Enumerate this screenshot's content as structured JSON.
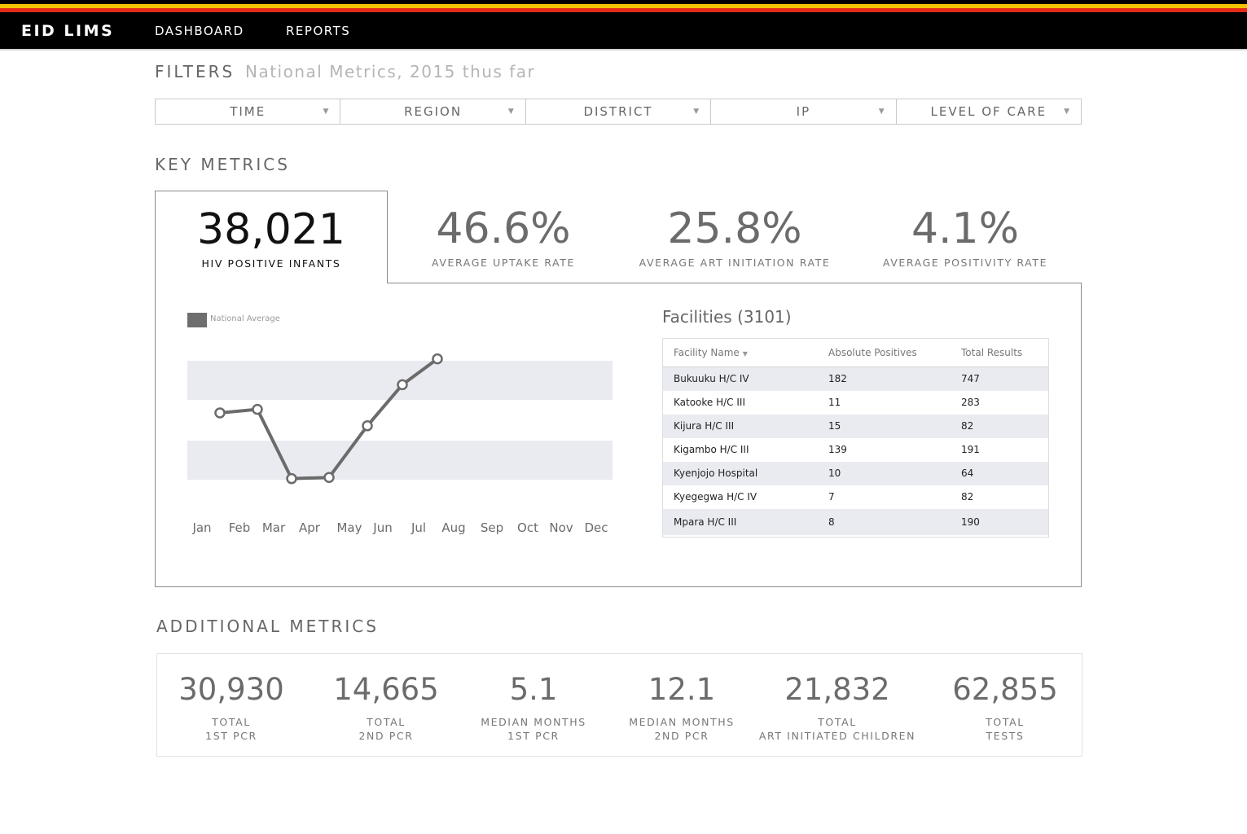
{
  "app": {
    "brand": "EID LIMS",
    "nav": [
      {
        "label": "DASHBOARD"
      },
      {
        "label": "REPORTS"
      }
    ],
    "stripe_colors": [
      "#000000",
      "#f2c400",
      "#e32b19",
      "#000000"
    ]
  },
  "filters": {
    "title": "FILTERS",
    "subtitle": "National Metrics, 2015 thus far",
    "items": [
      {
        "label": "TIME"
      },
      {
        "label": "REGION"
      },
      {
        "label": "DISTRICT"
      },
      {
        "label": "IP"
      },
      {
        "label": "LEVEL OF CARE"
      }
    ]
  },
  "key_metrics": {
    "title": "KEY METRICS",
    "items": [
      {
        "value": "38,021",
        "label": "HIV POSITIVE INFANTS",
        "active": true
      },
      {
        "value": "46.6%",
        "label": "AVERAGE UPTAKE RATE"
      },
      {
        "value": "25.8%",
        "label": "AVERAGE ART INITIATION RATE"
      },
      {
        "value": "4.1%",
        "label": "AVERAGE POSITIVITY RATE"
      }
    ]
  },
  "chart": {
    "legend": "National Average",
    "months": [
      "Jan",
      "Feb",
      "Mar",
      "Apr",
      "May",
      "Jun",
      "Jul",
      "Aug",
      "Sep",
      "Oct",
      "Nov",
      "Dec"
    ],
    "line_color": "#6b6b6b"
  },
  "chart_data": {
    "type": "line",
    "categories": [
      "Jan",
      "Feb",
      "Mar",
      "Apr",
      "May",
      "Jun",
      "Jul",
      "Aug",
      "Sep",
      "Oct",
      "Nov",
      "Dec"
    ],
    "series": [
      {
        "name": "National Average",
        "values": [
          0.59,
          0.62,
          0.03,
          0.04,
          0.48,
          0.83,
          1.05,
          null,
          null,
          null,
          null,
          null
        ]
      }
    ],
    "ylim": [
      0,
      1.2
    ],
    "legend_position": "top-left"
  },
  "facilities": {
    "title": "Facilities (3101)",
    "columns": [
      "Facility Name",
      "Absolute Positives",
      "Total Results"
    ],
    "rows": [
      {
        "name": "Bukuuku H/C IV",
        "positives": "182",
        "total": "747"
      },
      {
        "name": "Katooke H/C III",
        "positives": "11",
        "total": "283"
      },
      {
        "name": "Kijura H/C III",
        "positives": "15",
        "total": "82"
      },
      {
        "name": "Kigambo H/C III",
        "positives": "139",
        "total": "191"
      },
      {
        "name": "Kyenjojo Hospital",
        "positives": "10",
        "total": "64"
      },
      {
        "name": "Kyegegwa H/C IV",
        "positives": "7",
        "total": "82"
      },
      {
        "name": "Mpara H/C III",
        "positives": "8",
        "total": "190"
      }
    ]
  },
  "additional_metrics": {
    "title": "ADDITIONAL METRICS",
    "items": [
      {
        "value": "30,930",
        "line1": "TOTAL",
        "line2": "1ST PCR"
      },
      {
        "value": "14,665",
        "line1": "TOTAL",
        "line2": "2ND PCR"
      },
      {
        "value": "5.1",
        "line1": "MEDIAN MONTHS",
        "line2": "1ST PCR"
      },
      {
        "value": "12.1",
        "line1": "MEDIAN MONTHS",
        "line2": "2ND PCR"
      },
      {
        "value": "21,832",
        "line1": "TOTAL",
        "line2": "ART INITIATED CHILDREN"
      },
      {
        "value": "62,855",
        "line1": "TOTAL",
        "line2": "TESTS"
      }
    ]
  }
}
